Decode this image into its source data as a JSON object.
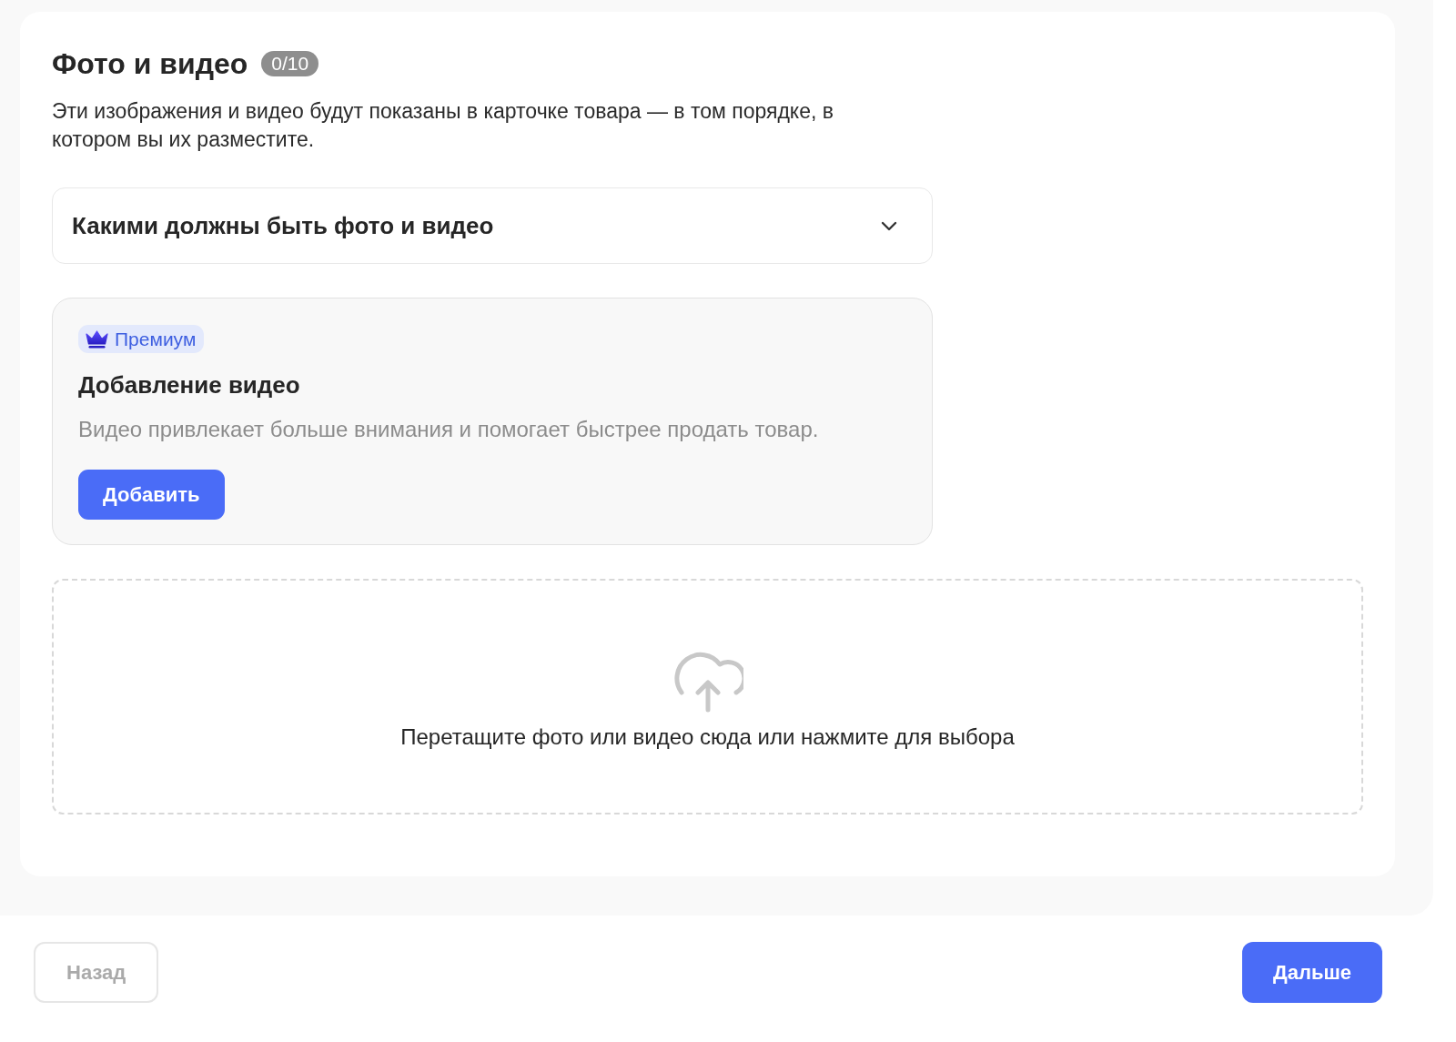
{
  "section": {
    "title": "Фото и видео",
    "counter": "0/10",
    "description": "Эти изображения и видео будут показаны в карточке товара — в том порядке, в котором вы их разместите."
  },
  "accordion": {
    "title": "Какими должны быть фото и видео",
    "expanded": false
  },
  "premium_card": {
    "badge": "Премиум",
    "title": "Добавление видео",
    "description": "Видео привлекает больше внимания и помогает быстрее продать товар.",
    "button": "Добавить"
  },
  "upload_area": {
    "hint": "Перетащите фото или видео сюда или нажмите для выбора"
  },
  "footer": {
    "buttons": [
      {
        "label": "Назад",
        "kind": "secondary",
        "disabled": true
      },
      {
        "label": "Дальше",
        "kind": "primary",
        "disabled": false
      }
    ]
  }
}
